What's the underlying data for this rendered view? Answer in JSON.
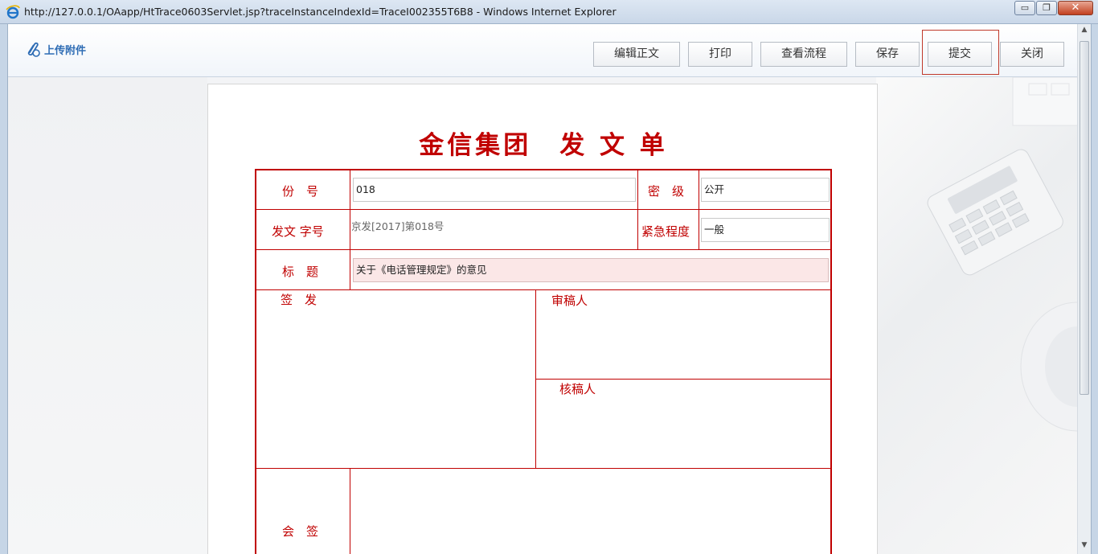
{
  "window": {
    "title": "http://127.0.0.1/OAapp/HtTrace0603Servlet.jsp?traceInstanceIndexId=TraceI002355T6B8 - Windows Internet Explorer",
    "minimize_glyph": "▭",
    "restore_glyph": "❐",
    "close_glyph": "✕"
  },
  "toolbar": {
    "attach_label": "上传附件",
    "edit_label": "编辑正文",
    "print_label": "打印",
    "flow_label": "查看流程",
    "save_label": "保存",
    "submit_label": "提交",
    "close_label": "关闭"
  },
  "document": {
    "title": "金信集团　发 文 单",
    "fields": {
      "copy_no_label": "份　号",
      "copy_no_value": "018",
      "secret_label": "密　级",
      "secret_value": "公开",
      "doc_no_label": "发文 字号",
      "doc_no_value": "京发[2017]第018号",
      "urgency_label": "紧急程度",
      "urgency_value": "一般",
      "subject_label": "标　题",
      "subject_value": "关于《电话管理规定》的意见",
      "sign_label": "签　发",
      "reviewer_label": "审稿人",
      "checker_label": "核稿人",
      "countersign_label": "会　签"
    }
  },
  "colors": {
    "accent_red": "#c00000",
    "link_blue": "#2f6db5"
  },
  "icons": [
    "ie-logo-icon",
    "paperclip-icon",
    "minimize-icon",
    "restore-icon",
    "close-icon",
    "scroll-up-icon",
    "scroll-down-icon"
  ]
}
